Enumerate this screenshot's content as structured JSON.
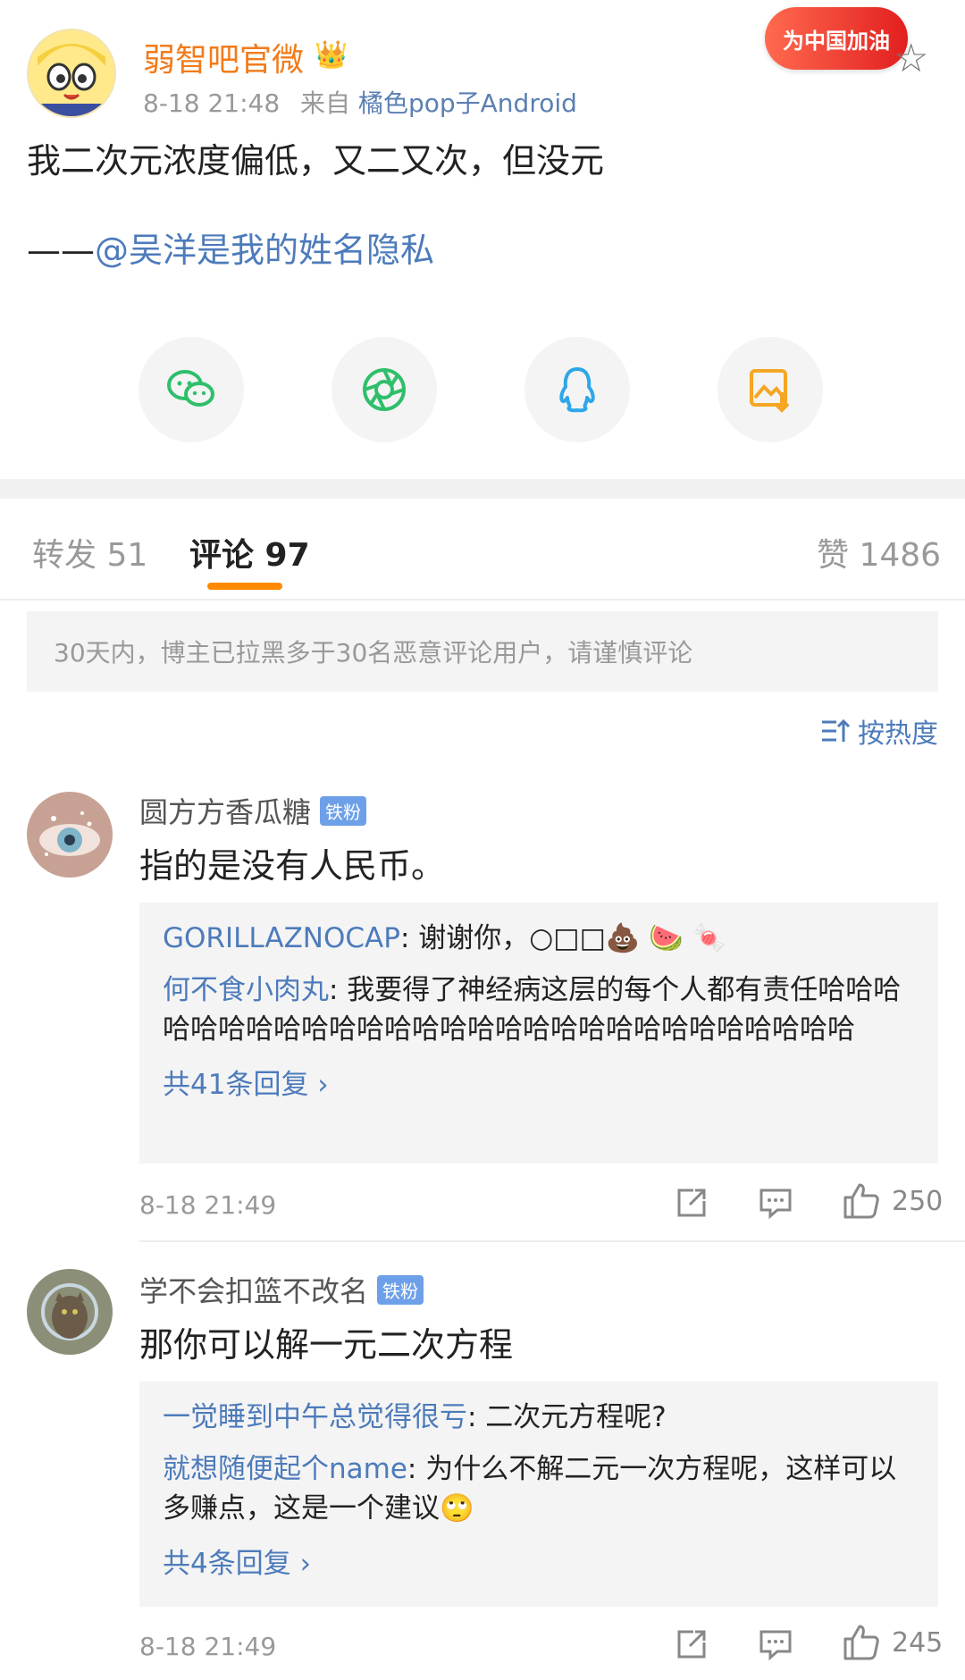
{
  "post": {
    "author": "弱智吧官微",
    "time": "8-18 21:48",
    "source_prefix": "来自",
    "source": "橘色pop子Android",
    "promo_badge": "为中国加油",
    "text_line1": "我二次元浓度偏低，又二又次，但没元",
    "dash": "——",
    "mention": "@吴洋是我的姓名隐私"
  },
  "share": {
    "icons": [
      "wechat-icon",
      "moments-icon",
      "qq-icon",
      "save-image-icon"
    ]
  },
  "tabs": {
    "repost": "转发 51",
    "comments": "评论 97",
    "likes": "赞 1486"
  },
  "notice": "30天内，博主已拉黑多于30名恶意评论用户，请谨慎评论",
  "sort_label": "按热度",
  "comments": [
    {
      "user": "圆方方香瓜糖",
      "badge": "铁粉",
      "text": "指的是没有人民币。",
      "replies": [
        {
          "user": "GORILLAZNOCAP",
          "text": ": 谢谢你，○□□💩 🍉 🍬"
        },
        {
          "user": "何不食小肉丸",
          "text": ": 我要得了神经病这层的每个人都有责任哈哈哈哈哈哈哈哈哈哈哈哈哈哈哈哈哈哈哈哈哈哈哈哈哈哈哈哈"
        }
      ],
      "more": "共41条回复 ›",
      "time": "8-18 21:49",
      "likes": "250"
    },
    {
      "user": "学不会扣篮不改名",
      "badge": "铁粉",
      "text": "那你可以解一元二次方程",
      "replies": [
        {
          "user": "一觉睡到中午总觉得很亏",
          "text": ": 二次元方程呢?"
        },
        {
          "user": "就想随便起个name",
          "text": ": 为什么不解二元一次方程呢，这样可以多赚点，这是一个建议🙄"
        }
      ],
      "more": "共4条回复 ›",
      "time": "8-18 21:49",
      "likes": "245"
    }
  ]
}
